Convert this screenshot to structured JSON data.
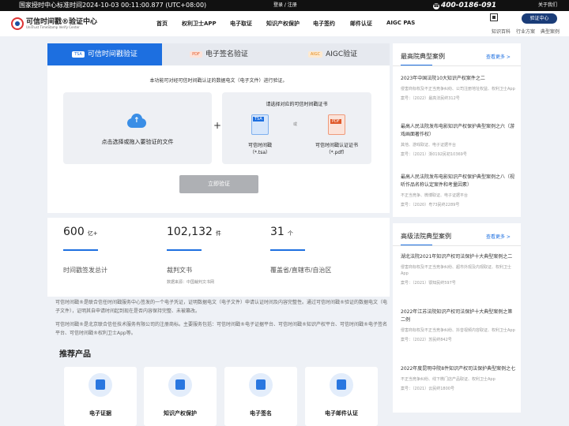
{
  "topbar": {
    "time": "国家授时中心标准时间2024-10-03 00:11:00.877 (UTC+08:00)",
    "login": "登录 / 注册",
    "phone": "400-0186-091",
    "about": "关于我们"
  },
  "brand": {
    "name": "可信时间戳®验证中心",
    "sub": "UniTrust TimeStamp Verify Center"
  },
  "nav": [
    "首页",
    "权利卫士APP",
    "电子取证",
    "知识产权保护",
    "电子签约",
    "邮件认证",
    "AIGC PAS"
  ],
  "header_right": {
    "verify_button": "验证中心",
    "links": [
      "知识百科",
      "行业方案",
      "典型案例"
    ]
  },
  "tabs": [
    {
      "badge": "TSA",
      "label": "可信时间戳验证"
    },
    {
      "badge": "PDF",
      "label": "电子签名验证"
    },
    {
      "badge": "AIGC",
      "label": "AIGC验证"
    }
  ],
  "verify": {
    "intro": "本功能可对经可信时间戳认证的数据电文（电子文件）进行验证。",
    "upload_label": "点击选择或拖入要验证的文件",
    "choose_title": "请选择对应的可信时间戳证书",
    "or": "或",
    "opt1_line1": "可信时间戳",
    "opt1_line2": "（*.tsa）",
    "opt2_line1": "可信时间戳认证证书",
    "opt2_line2": "（*.pdf）",
    "doc1_badge": "TSA",
    "doc2_badge": "PDF",
    "submit": "立即验证",
    "plus": "+"
  },
  "stats": [
    {
      "value": "600",
      "unit": "亿+",
      "label": "时间戳签发总计",
      "source": ""
    },
    {
      "value": "102,132",
      "unit": "件",
      "label": "裁判文书",
      "source": "数据来源：中国裁判文书网"
    },
    {
      "value": "31",
      "unit": "个",
      "label": "覆盖省/直辖市/自治区",
      "source": ""
    }
  ],
  "description": [
    "可信时间戳®是联合信任时间戳服务中心签发的一个电子凭证，证明数据电文（电子文件）申请认证时间及内容完整性。通过可信时间戳®验证的数据电文（电子文件），证明其自申请时间起到现在是否内容保持完整、未被篡改。",
    "可信时间戳®是北京联合信任技术服务有限公司的注册商标。主要服务包括：可信时间戳®电子证据平台、可信时间戳®知识产权平台、可信时间戳®电子签名平台、可信时间戳®权利卫士App等。"
  ],
  "products": {
    "title": "推荐产品",
    "items": [
      "电子证据",
      "知识产权保护",
      "电子签名",
      "电子邮件认证"
    ]
  },
  "cases_supreme": {
    "title": "最高院典型案例",
    "more": "查看更多 >",
    "items": [
      {
        "title": "2023年中国法院10大知识产权案件之二",
        "desc": "侵害商标权及不正当竞争纠纷、公司注册地址权益、权利卫士App",
        "no": "案号：（2022）最高法民终312号"
      },
      {
        "title": "最高人民法院发布电影知识产权保护典型案例之六（游戏画面著作权）",
        "desc": "其他、游戏取证、电子证据平台",
        "no": "案号：（2021）浙0192民初10369号"
      },
      {
        "title": "最高人民法院发布电影知识产权保护典型案例之八（视听作品名称认定案件和考量因素）",
        "desc": "不正当竞争、微博取证、电子证据平台",
        "no": "案号：（2020）粤73民终2289号"
      }
    ]
  },
  "cases_high": {
    "title": "高级法院典型案例",
    "more": "查看更多 >",
    "items": [
      {
        "title": "湖北法院2021年知识产权司法保护十大典型案例之二",
        "desc": "侵害商标权及不正当竞争纠纷、超市外观及内观取证、权利卫士App",
        "no": "案号：（2021）鄂知民终597号"
      },
      {
        "title": "2022年江苏法院知识产权司法保护十大典型案例之第二例",
        "desc": "侵害商标权及不正当竞争纠纷、抖音视频内容取证、权利卫士App",
        "no": "案号：（2022）苏民终842号"
      },
      {
        "title": "2022年度昆明中院8件知识产权司法保护典型案例之七",
        "desc": "不正当竞争纠纷、线下微门店产品取证、权利卫士App",
        "no": "案号：（2021）云民终1800号"
      }
    ]
  }
}
